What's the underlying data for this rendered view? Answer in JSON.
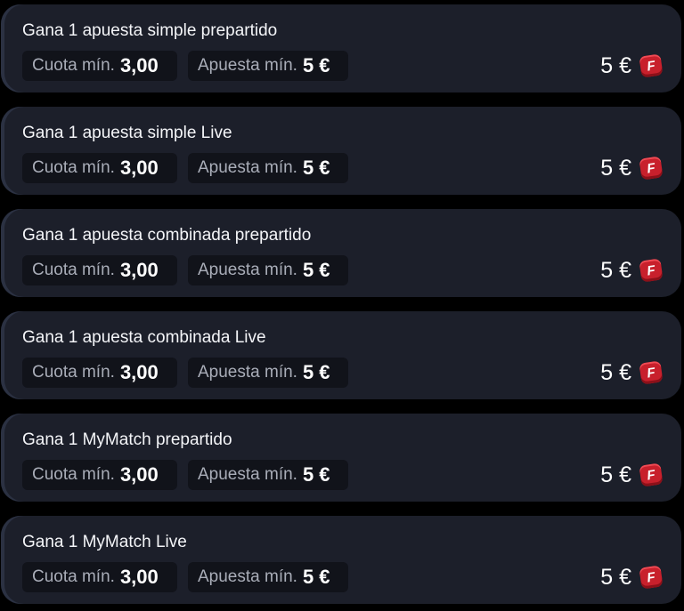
{
  "offers": [
    {
      "title": "Gana 1 apuesta simple prepartido",
      "min_odds_label": "Cuota mín.",
      "min_odds_value": "3,00",
      "min_stake_label": "Apuesta mín.",
      "min_stake_value": "5 €",
      "reward": "5 €",
      "reward_icon": "freebet-token-icon"
    },
    {
      "title": "Gana 1 apuesta simple Live",
      "min_odds_label": "Cuota mín.",
      "min_odds_value": "3,00",
      "min_stake_label": "Apuesta mín.",
      "min_stake_value": "5 €",
      "reward": "5 €",
      "reward_icon": "freebet-token-icon"
    },
    {
      "title": "Gana 1 apuesta combinada prepartido",
      "min_odds_label": "Cuota mín.",
      "min_odds_value": "3,00",
      "min_stake_label": "Apuesta mín.",
      "min_stake_value": "5 €",
      "reward": "5 €",
      "reward_icon": "freebet-token-icon"
    },
    {
      "title": "Gana 1 apuesta combinada Live",
      "min_odds_label": "Cuota mín.",
      "min_odds_value": "3,00",
      "min_stake_label": "Apuesta mín.",
      "min_stake_value": "5 €",
      "reward": "5 €",
      "reward_icon": "freebet-token-icon"
    },
    {
      "title": "Gana 1 MyMatch prepartido",
      "min_odds_label": "Cuota mín.",
      "min_odds_value": "3,00",
      "min_stake_label": "Apuesta mín.",
      "min_stake_value": "5 €",
      "reward": "5 €",
      "reward_icon": "freebet-token-icon"
    },
    {
      "title": "Gana 1 MyMatch Live",
      "min_odds_label": "Cuota mín.",
      "min_odds_value": "3,00",
      "min_stake_label": "Apuesta mín.",
      "min_stake_value": "5 €",
      "reward": "5 €",
      "reward_icon": "freebet-token-icon"
    }
  ],
  "token_letter": "F",
  "colors": {
    "background": "#000000",
    "card": "#1c1f2a",
    "chip": "#11131a",
    "token": "#c8202c"
  }
}
